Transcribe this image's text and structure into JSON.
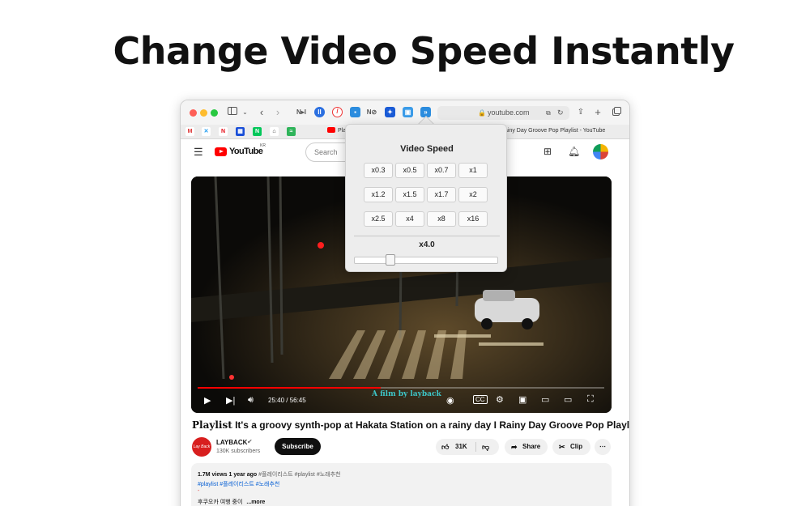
{
  "headline": "Change Video Speed Instantly",
  "browser": {
    "url": "youtube.com",
    "tabs": [
      {
        "label": "Pla"
      },
      {
        "label": "ainy Day Groove Pop Playlist - YouTube"
      }
    ]
  },
  "youtube": {
    "logo_text": "YouTube",
    "region": "KR",
    "search_placeholder": "Search",
    "time": "25:40 / 56:45",
    "watermark": "A film by layback",
    "title_prefix": "Playlist",
    "title": "It's a groovy synth-pop at Hakata Station on a rainy day I Rainy Day Groove Pop Playlist",
    "channel": {
      "name": "LAYBACK",
      "subscribers": "130K subscribers",
      "avatar_text": "Lay Back"
    },
    "subscribe_label": "Subscribe",
    "likes": "31K",
    "share_label": "Share",
    "clip_label": "Clip",
    "description": {
      "stats": "1.7M views  1 year ago",
      "tags_inline": "#플레이리스트 #playlist #노래추천",
      "tags": "#playlist #플레이리스트 #노래추천",
      "dash": "-",
      "text": "후쿠오카 여행 중이",
      "more": "...more"
    }
  },
  "popup": {
    "title": "Video Speed",
    "speeds": [
      "x0.3",
      "x0.5",
      "x0.7",
      "x1",
      "x1.2",
      "x1.5",
      "x1.7",
      "x2",
      "x2.5",
      "x4",
      "x8",
      "x16"
    ],
    "current": "x4.0",
    "slider_fraction": 0.25
  },
  "colors": {
    "youtube_red": "#ff0000",
    "extension_blue": "#2b8cde"
  }
}
